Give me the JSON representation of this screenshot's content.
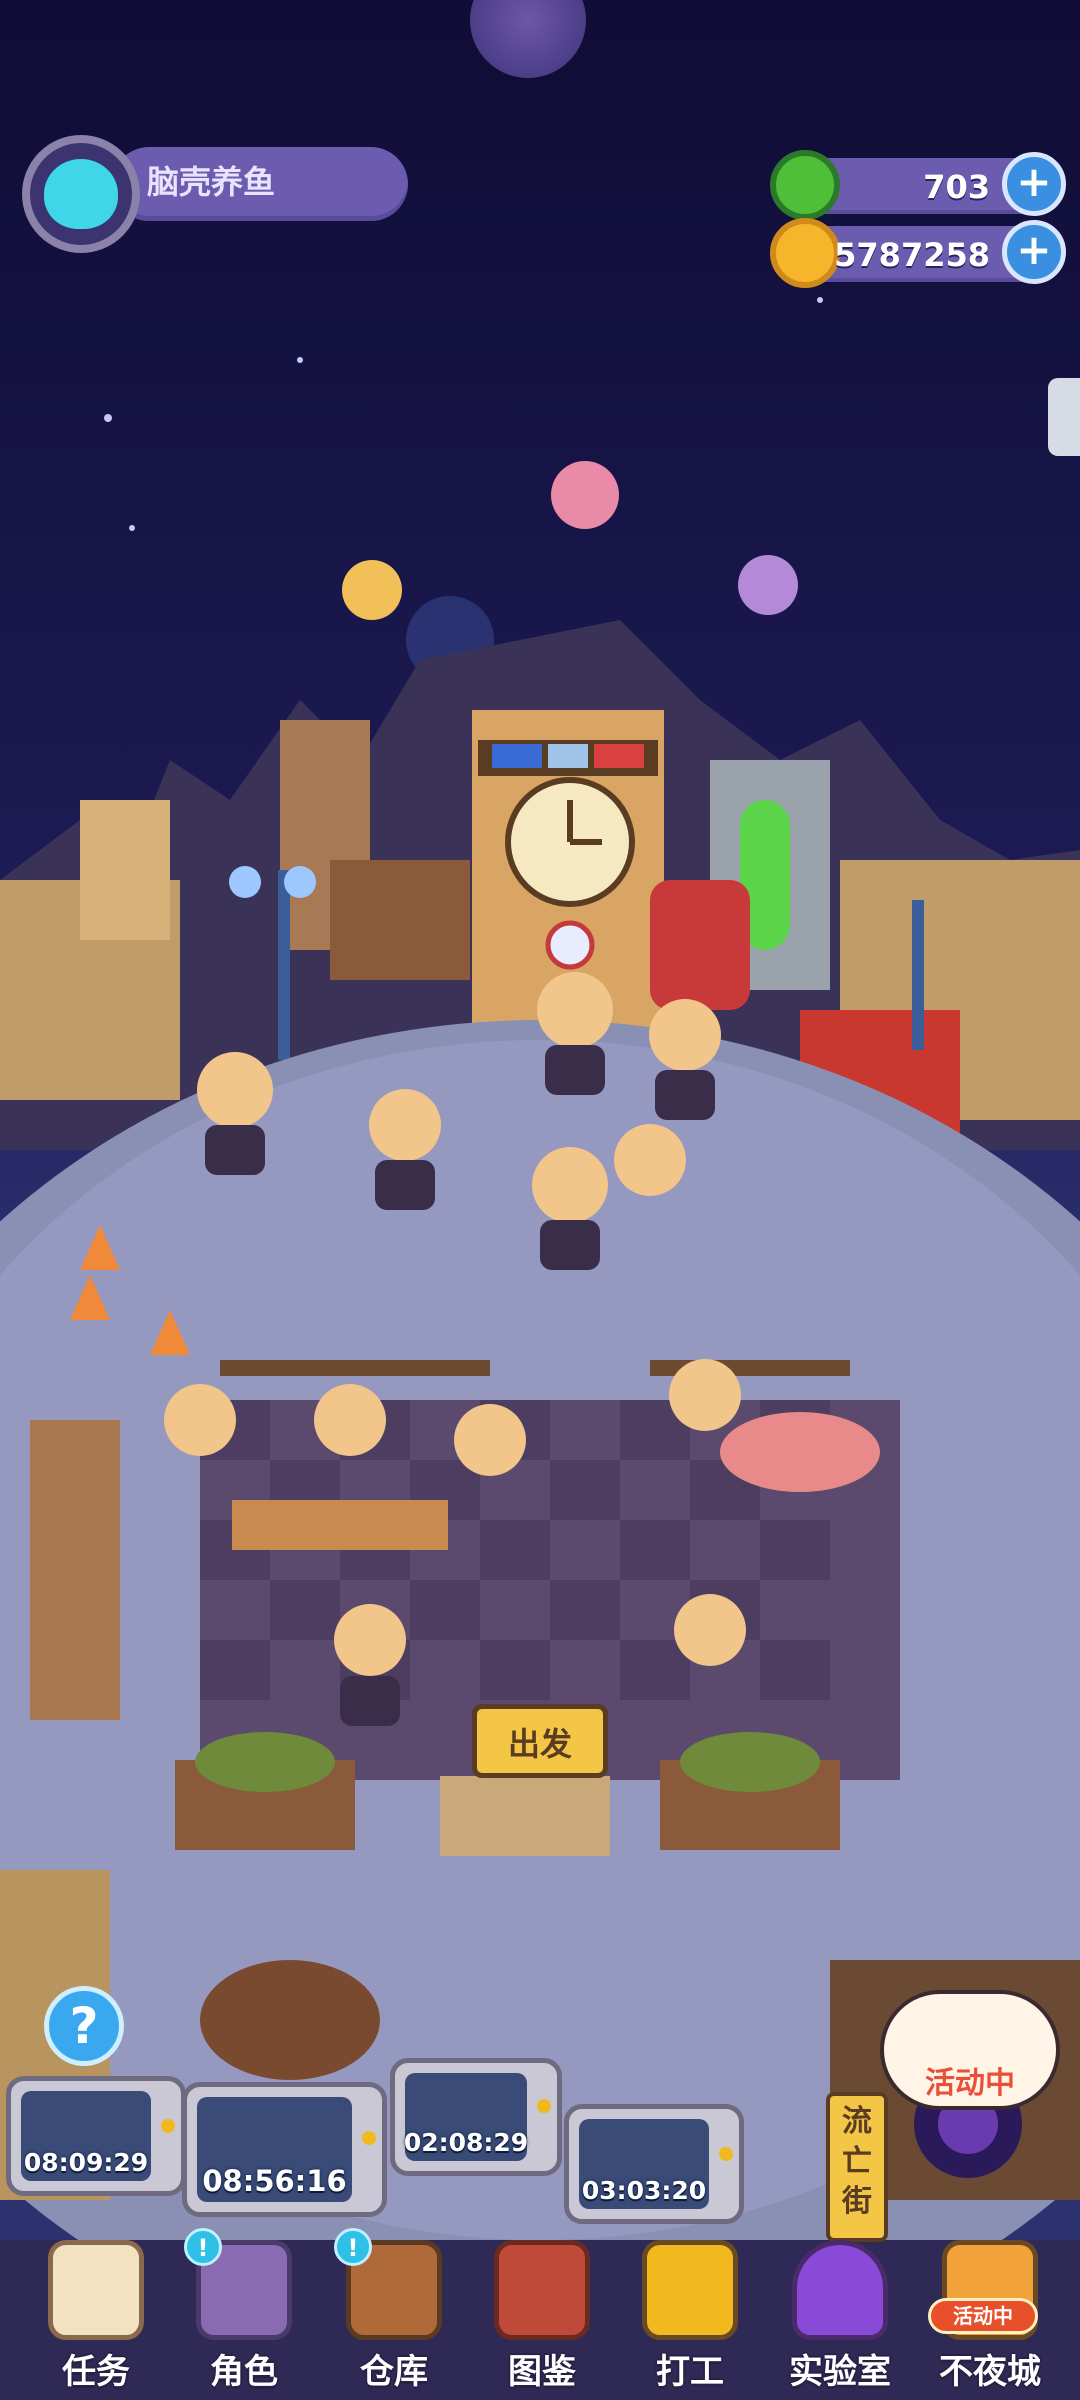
{
  "player": {
    "name": "脑壳养鱼"
  },
  "resources": {
    "gems": "703",
    "coins": "5787258"
  },
  "scene": {
    "depart_label": "出发",
    "street_label": "流亡街",
    "event_label": "活动中"
  },
  "timers": [
    "08:09:29",
    "08:56:16",
    "02:08:29",
    "03:03:20"
  ],
  "nav": [
    {
      "label": "任务"
    },
    {
      "label": "角色",
      "badge": "!"
    },
    {
      "label": "仓库",
      "badge": "!"
    },
    {
      "label": "图鉴"
    },
    {
      "label": "打工"
    },
    {
      "label": "实验室"
    },
    {
      "label": "不夜城",
      "tag": "活动中"
    }
  ],
  "colors": {
    "sky": "#1a1646",
    "ground": "#8a8fb4",
    "hud_bar": "#6b5cb0",
    "accent": "#f4c646"
  }
}
